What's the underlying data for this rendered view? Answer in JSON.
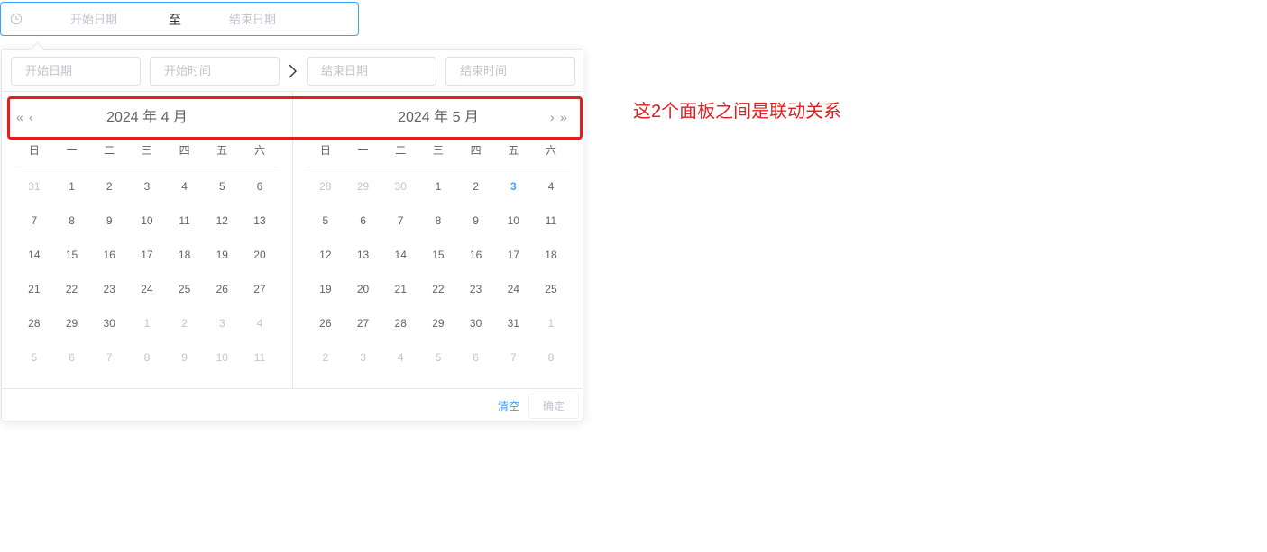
{
  "range_input": {
    "start_placeholder": "开始日期",
    "separator": "至",
    "end_placeholder": "结束日期",
    "icon": "clock-icon"
  },
  "panel_header": {
    "start_date_placeholder": "开始日期",
    "start_time_placeholder": "开始时间",
    "end_date_placeholder": "结束日期",
    "end_time_placeholder": "结束时间"
  },
  "weekdays": [
    "日",
    "一",
    "二",
    "三",
    "四",
    "五",
    "六"
  ],
  "left_month": {
    "title": "2024 年 4 月",
    "prev_year": "«",
    "prev_month": "‹",
    "weeks": [
      [
        {
          "d": "31",
          "m": true
        },
        {
          "d": "1"
        },
        {
          "d": "2"
        },
        {
          "d": "3"
        },
        {
          "d": "4"
        },
        {
          "d": "5"
        },
        {
          "d": "6"
        }
      ],
      [
        {
          "d": "7"
        },
        {
          "d": "8"
        },
        {
          "d": "9"
        },
        {
          "d": "10"
        },
        {
          "d": "11"
        },
        {
          "d": "12"
        },
        {
          "d": "13"
        }
      ],
      [
        {
          "d": "14"
        },
        {
          "d": "15"
        },
        {
          "d": "16"
        },
        {
          "d": "17"
        },
        {
          "d": "18"
        },
        {
          "d": "19"
        },
        {
          "d": "20"
        }
      ],
      [
        {
          "d": "21"
        },
        {
          "d": "22"
        },
        {
          "d": "23"
        },
        {
          "d": "24"
        },
        {
          "d": "25"
        },
        {
          "d": "26"
        },
        {
          "d": "27"
        }
      ],
      [
        {
          "d": "28"
        },
        {
          "d": "29"
        },
        {
          "d": "30"
        },
        {
          "d": "1",
          "m": true
        },
        {
          "d": "2",
          "m": true
        },
        {
          "d": "3",
          "m": true
        },
        {
          "d": "4",
          "m": true
        }
      ],
      [
        {
          "d": "5",
          "m": true
        },
        {
          "d": "6",
          "m": true
        },
        {
          "d": "7",
          "m": true
        },
        {
          "d": "8",
          "m": true
        },
        {
          "d": "9",
          "m": true
        },
        {
          "d": "10",
          "m": true
        },
        {
          "d": "11",
          "m": true
        }
      ]
    ]
  },
  "right_month": {
    "title": "2024 年 5 月",
    "next_month": "›",
    "next_year": "»",
    "weeks": [
      [
        {
          "d": "28",
          "m": true
        },
        {
          "d": "29",
          "m": true
        },
        {
          "d": "30",
          "m": true
        },
        {
          "d": "1"
        },
        {
          "d": "2"
        },
        {
          "d": "3",
          "today": true
        },
        {
          "d": "4"
        }
      ],
      [
        {
          "d": "5"
        },
        {
          "d": "6"
        },
        {
          "d": "7"
        },
        {
          "d": "8"
        },
        {
          "d": "9"
        },
        {
          "d": "10"
        },
        {
          "d": "11"
        }
      ],
      [
        {
          "d": "12"
        },
        {
          "d": "13"
        },
        {
          "d": "14"
        },
        {
          "d": "15"
        },
        {
          "d": "16"
        },
        {
          "d": "17"
        },
        {
          "d": "18"
        }
      ],
      [
        {
          "d": "19"
        },
        {
          "d": "20"
        },
        {
          "d": "21"
        },
        {
          "d": "22"
        },
        {
          "d": "23"
        },
        {
          "d": "24"
        },
        {
          "d": "25"
        }
      ],
      [
        {
          "d": "26"
        },
        {
          "d": "27"
        },
        {
          "d": "28"
        },
        {
          "d": "29"
        },
        {
          "d": "30"
        },
        {
          "d": "31"
        },
        {
          "d": "1",
          "m": true
        }
      ],
      [
        {
          "d": "2",
          "m": true
        },
        {
          "d": "3",
          "m": true
        },
        {
          "d": "4",
          "m": true
        },
        {
          "d": "5",
          "m": true
        },
        {
          "d": "6",
          "m": true
        },
        {
          "d": "7",
          "m": true
        },
        {
          "d": "8",
          "m": true
        }
      ]
    ]
  },
  "footer": {
    "clear_label": "清空",
    "confirm_label": "确定"
  },
  "annotation": {
    "text": "这2个面板之间是联动关系",
    "color": "#e02020"
  },
  "colors": {
    "accent": "#409eff",
    "muted": "#c0c4cc",
    "text": "#606266"
  }
}
